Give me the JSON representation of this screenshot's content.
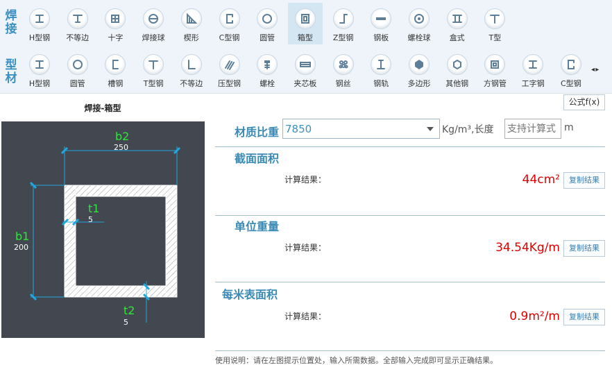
{
  "categories": {
    "welding": [
      "焊",
      "接"
    ],
    "profile": [
      "型",
      "材"
    ]
  },
  "welding_tools": [
    {
      "name": "h-beam-icon",
      "label": "H型钢"
    },
    {
      "name": "unequal-icon",
      "label": "不等边"
    },
    {
      "name": "cross-icon",
      "label": "十字"
    },
    {
      "name": "weld-ball-icon",
      "label": "焊接球"
    },
    {
      "name": "wedge-icon",
      "label": "楔形"
    },
    {
      "name": "c-beam-icon",
      "label": "C型钢"
    },
    {
      "name": "round-tube-icon",
      "label": "圆管"
    },
    {
      "name": "box-icon",
      "label": "箱型"
    },
    {
      "name": "z-beam-icon",
      "label": "Z型钢"
    },
    {
      "name": "steel-plate-icon",
      "label": "钢板"
    },
    {
      "name": "bolt-ball-icon",
      "label": "螺栓球"
    },
    {
      "name": "box-type-icon",
      "label": "盒式"
    },
    {
      "name": "t-beam-icon",
      "label": "T型"
    }
  ],
  "profile_tools": [
    {
      "name": "h-beam-icon",
      "label": "H型钢"
    },
    {
      "name": "round-tube-icon",
      "label": "圆管"
    },
    {
      "name": "channel-icon",
      "label": "槽钢"
    },
    {
      "name": "t-beam-icon",
      "label": "T型钢"
    },
    {
      "name": "unequal-angle-icon",
      "label": "不等边"
    },
    {
      "name": "pressed-steel-icon",
      "label": "压型钢"
    },
    {
      "name": "bolt-icon",
      "label": "螺栓"
    },
    {
      "name": "sandwich-panel-icon",
      "label": "夹芯板"
    },
    {
      "name": "steel-wire-icon",
      "label": "钢丝"
    },
    {
      "name": "rail-icon",
      "label": "钢轨"
    },
    {
      "name": "polygon-icon",
      "label": "多边形"
    },
    {
      "name": "other-steel-icon",
      "label": "其他钢"
    },
    {
      "name": "square-tube-icon",
      "label": "方钢管"
    },
    {
      "name": "i-beam-icon",
      "label": "工字钢"
    },
    {
      "name": "c-beam-icon",
      "label": "C型钢"
    }
  ],
  "selected_tool": "箱型",
  "pager": "◂ ▸",
  "shape_title": "焊接-箱型",
  "dimensions": {
    "b2": {
      "name": "b2",
      "value": "250"
    },
    "b1": {
      "name": "b1",
      "value": "200"
    },
    "t1": {
      "name": "t1",
      "value": "5"
    },
    "t2": {
      "name": "t2",
      "value": "5"
    }
  },
  "formula_button": "公式f(x)",
  "material": {
    "label": "材质比重",
    "density": "7850",
    "unit": "Kg/m³,长度",
    "length_placeholder": "支持计算式",
    "length_unit": "m"
  },
  "sections": [
    {
      "title": "截面面积",
      "calc_label": "计算结果：",
      "result": "44cm²",
      "copy": "复制结果"
    },
    {
      "title": "单位重量",
      "calc_label": "计算结果：",
      "result": "34.54Kg/m",
      "copy": "复制结果"
    },
    {
      "title": "每米表面积",
      "calc_label": "计算结果：",
      "result": "0.9m²/m",
      "copy": "复制结果"
    }
  ],
  "footer": "使用说明：请在左图提示位置处，输入所需数据。全部输入完成即可显示正确结果。",
  "colors": {
    "accent": "#3b8fc4",
    "result": "#e00000",
    "dimension_name": "#2ee63a",
    "canvas_bg": "#434850",
    "dim_line": "#22a6e0"
  }
}
